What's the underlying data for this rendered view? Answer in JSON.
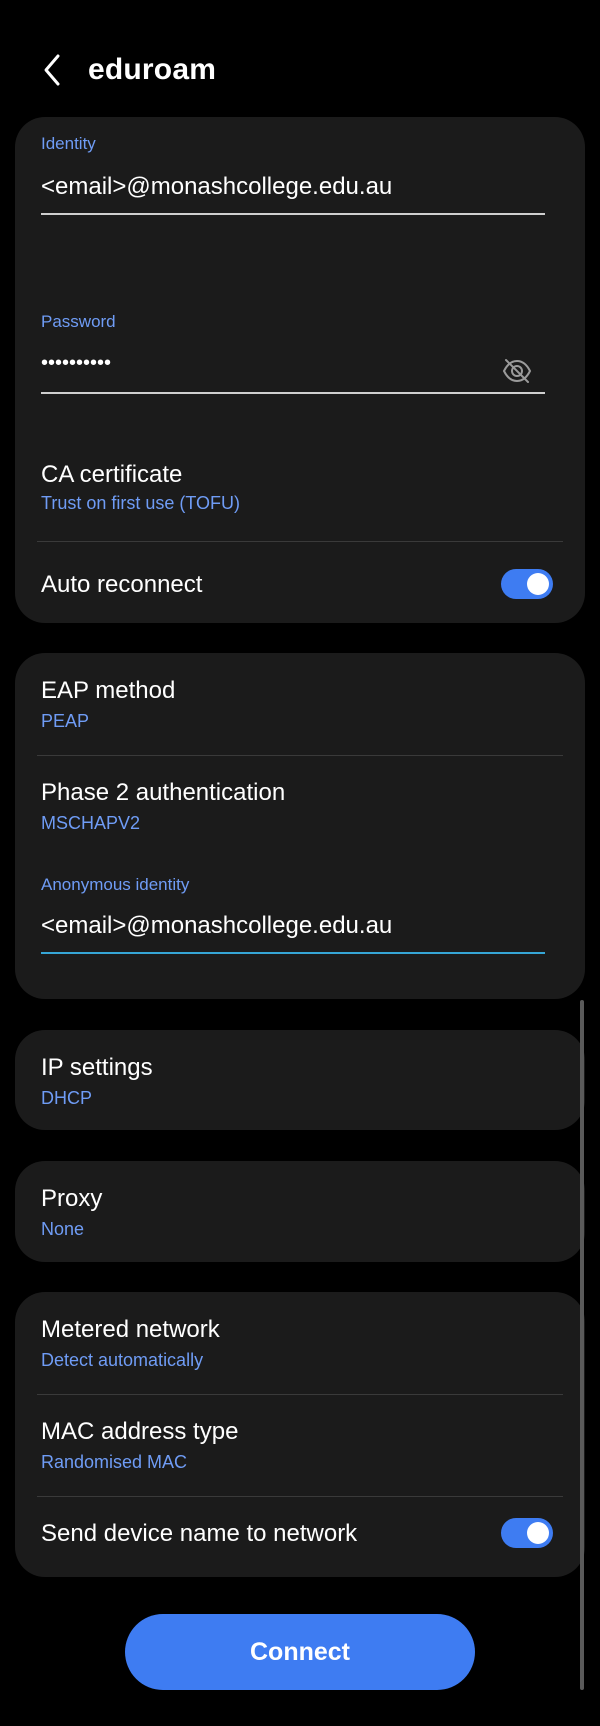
{
  "header": {
    "title": "eduroam",
    "back_icon": "chevron-left-icon"
  },
  "security_card": {
    "identity": {
      "label": "Identity",
      "value": "<email>@monashcollege.edu.au"
    },
    "password": {
      "label": "Password",
      "value": "••••••••••",
      "visibility_icon": "eye-off-icon"
    },
    "ca_certificate": {
      "title": "CA certificate",
      "value": "Trust on first use (TOFU)"
    },
    "auto_reconnect": {
      "title": "Auto reconnect",
      "enabled": true
    }
  },
  "eap_card": {
    "eap_method": {
      "title": "EAP method",
      "value": "PEAP"
    },
    "phase2": {
      "title": "Phase 2 authentication",
      "value": "MSCHAPV2"
    },
    "anonymous_identity": {
      "label": "Anonymous identity",
      "value": "<email>@monashcollege.edu.au"
    }
  },
  "ip_card": {
    "title": "IP settings",
    "value": "DHCP"
  },
  "proxy_card": {
    "title": "Proxy",
    "value": "None"
  },
  "network_card": {
    "metered": {
      "title": "Metered network",
      "value": "Detect automatically"
    },
    "mac": {
      "title": "MAC address type",
      "value": "Randomised MAC"
    },
    "send_device_name": {
      "title": "Send device name to network",
      "enabled": true
    }
  },
  "connect_button": {
    "label": "Connect"
  },
  "colors": {
    "background": "#000000",
    "card": "#1b1b1b",
    "accent_text": "#6f9cf5",
    "toggle_on": "#3e7cf2",
    "button": "#3e7cf2",
    "active_underline": "#36a6d6"
  }
}
